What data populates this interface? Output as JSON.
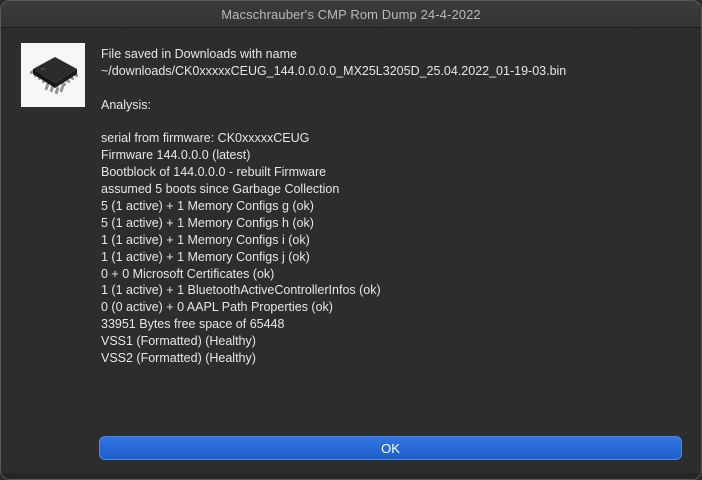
{
  "window": {
    "title": "Macschrauber's CMP Rom Dump 24-4-2022"
  },
  "icon": {
    "name": "chip-icon"
  },
  "message": {
    "saved_line": "File saved in Downloads with name",
    "filename": "~/downloads/CK0xxxxxCEUG_144.0.0.0.0_MX25L3205D_25.04.2022_01-19-03.bin",
    "analysis_header": "Analysis:",
    "details": [
      "serial from firmware: CK0xxxxxCEUG",
      "Firmware 144.0.0.0 (latest)",
      "Bootblock of 144.0.0.0 - rebuilt Firmware",
      "assumed 5 boots since Garbage Collection",
      "5 (1 active) + 1 Memory Configs g (ok)",
      "5 (1 active) + 1 Memory Configs h (ok)",
      "1 (1 active) + 1 Memory Configs i (ok)",
      "1 (1 active) + 1 Memory Configs j (ok)",
      "0 + 0 Microsoft Certificates (ok)",
      "1 (1 active) + 1 BluetoothActiveControllerInfos (ok)",
      "0 (0 active) + 0 AAPL Path Properties (ok)",
      "33951 Bytes free space of 65448",
      "VSS1 (Formatted) (Healthy)",
      "VSS2 (Formatted) (Healthy)"
    ]
  },
  "buttons": {
    "ok_label": "OK"
  },
  "colors": {
    "accent": "#2a6bd8",
    "background": "#2d2d2d",
    "text": "#e6e6e6"
  }
}
